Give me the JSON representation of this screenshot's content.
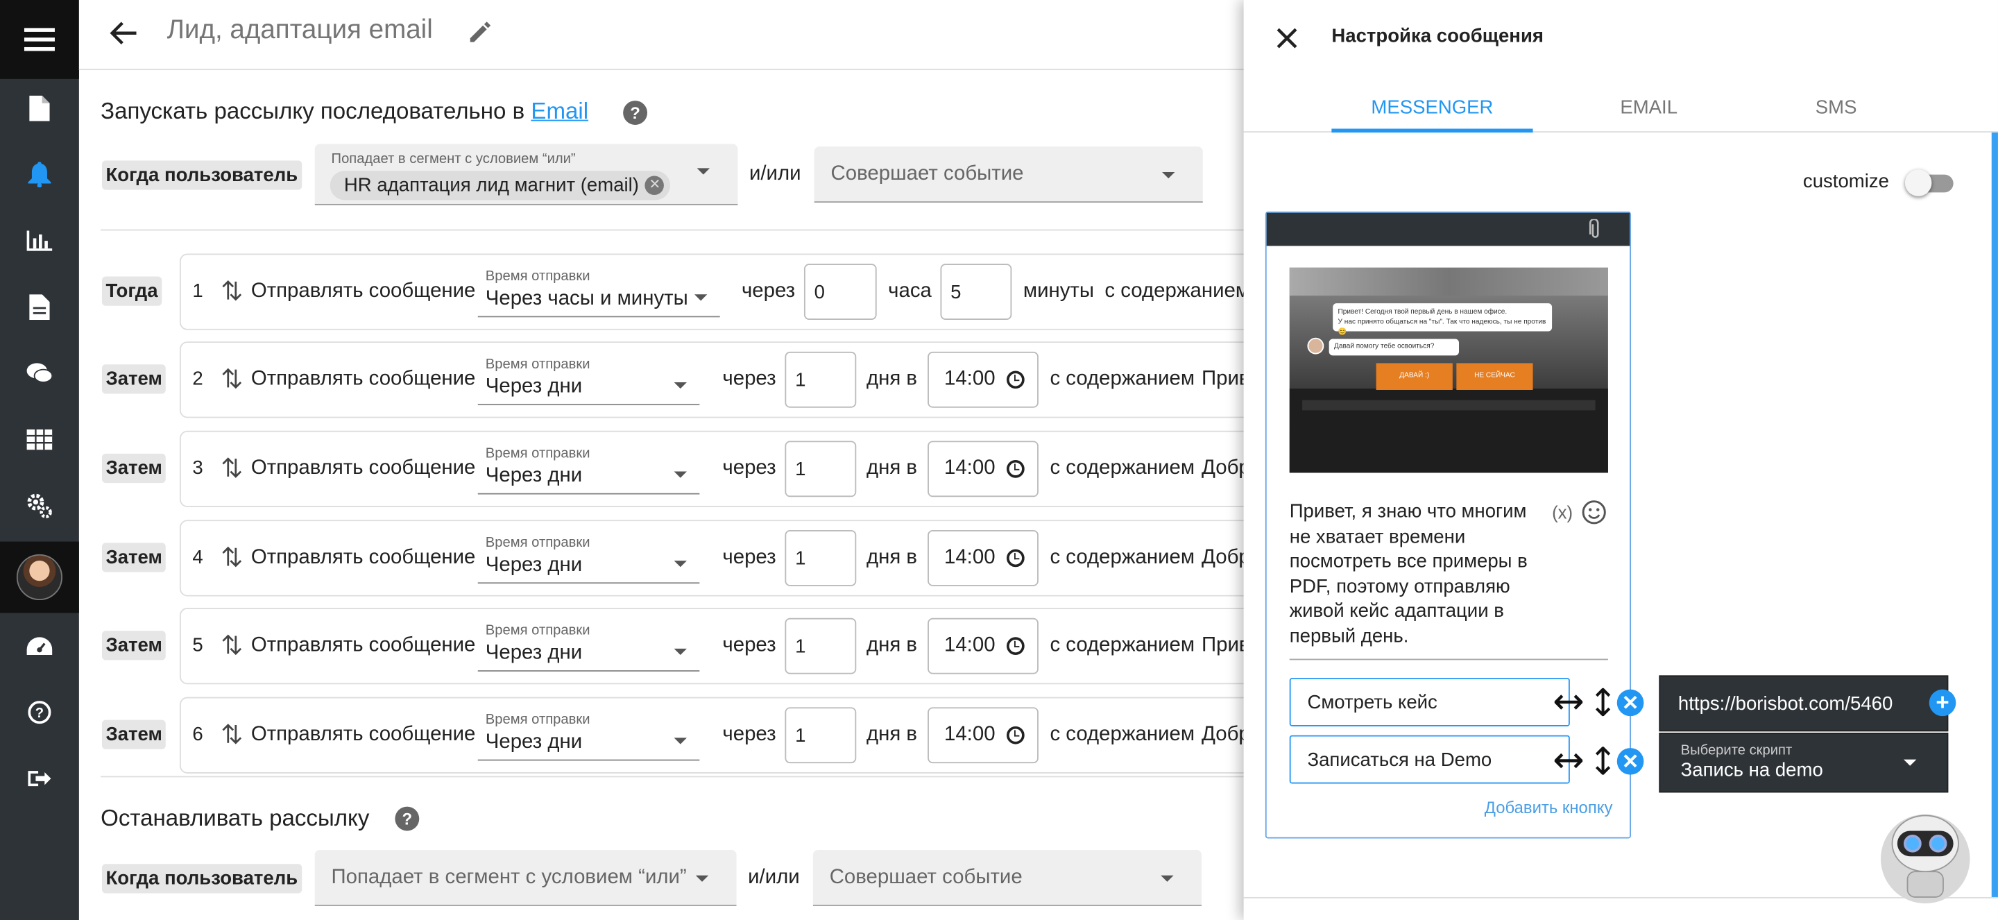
{
  "header": {
    "title": "Лид, адаптация email"
  },
  "start_section": {
    "heading": "Запускать рассылку последовательно в",
    "channel_link": "Email",
    "when_label": "Когда пользователь",
    "segment_label": "Попадает в сегмент с условием “или”",
    "segment_chip": "HR адаптация лид магнит (email)",
    "andor": "и/или",
    "event_placeholder": "Совершает событие"
  },
  "steps": [
    {
      "label": "Тогда",
      "num": "1",
      "action": "Отправлять сообщение",
      "time_label": "Время отправки",
      "time_mode": "Через часы и минуты",
      "via": "через",
      "v1": "0",
      "u1": "часа",
      "v2": "5",
      "u2": "минуты",
      "content": "с содержанием",
      "preview": ""
    },
    {
      "label": "Затем",
      "num": "2",
      "action": "Отправлять сообщение",
      "time_label": "Время отправки",
      "time_mode": "Через дни",
      "via": "через",
      "v1": "1",
      "u1": "дня в",
      "time": "14:00",
      "content": "с содержанием",
      "preview": "Прив"
    },
    {
      "label": "Затем",
      "num": "3",
      "action": "Отправлять сообщение",
      "time_label": "Время отправки",
      "time_mode": "Через дни",
      "via": "через",
      "v1": "1",
      "u1": "дня в",
      "time": "14:00",
      "content": "с содержанием",
      "preview": "Добр"
    },
    {
      "label": "Затем",
      "num": "4",
      "action": "Отправлять сообщение",
      "time_label": "Время отправки",
      "time_mode": "Через дни",
      "via": "через",
      "v1": "1",
      "u1": "дня в",
      "time": "14:00",
      "content": "с содержанием",
      "preview": "Добр"
    },
    {
      "label": "Затем",
      "num": "5",
      "action": "Отправлять сообщение",
      "time_label": "Время отправки",
      "time_mode": "Через дни",
      "via": "через",
      "v1": "1",
      "u1": "дня в",
      "time": "14:00",
      "content": "с содержанием",
      "preview": "Прив"
    },
    {
      "label": "Затем",
      "num": "6",
      "action": "Отправлять сообщение",
      "time_label": "Время отправки",
      "time_mode": "Через дни",
      "via": "через",
      "v1": "1",
      "u1": "дня в",
      "time": "14:00",
      "content": "с содержанием",
      "preview": "Добр"
    }
  ],
  "stop_section": {
    "heading": "Останавливать рассылку",
    "when_label": "Когда пользователь",
    "segment_placeholder": "Попадает в сегмент с условием “или”",
    "andor": "и/или",
    "event_placeholder": "Совершает событие"
  },
  "panel": {
    "title": "Настройка сообщения",
    "tabs": [
      "MESSENGER",
      "EMAIL",
      "SMS"
    ],
    "active_tab": "MESSENGER",
    "customize_label": "customize",
    "photo_chat": {
      "line1": "Привет! Сегодня твой первый день в нашем офисе.",
      "line2": "У нас принято общаться на \"ты\". Так что надеюсь, ты не против 😊",
      "line3": "Давай помогу тебе освоиться?",
      "btn1": "ДАВАЙ :)",
      "btn2": "НЕ СЕЙЧАС"
    },
    "message_text": "Привет, я знаю что многим не хватает времени посмотреть все примеры в PDF, поэтому отправляю живой кейс адаптации в первый день.",
    "var_token": "(x)",
    "buttons": [
      {
        "label": "Смотреть кейс",
        "target": "https://borisbot.com/5460"
      },
      {
        "label": "Записаться на Demo",
        "target_label": "Выберите скрипт",
        "target": "Запись на demo"
      }
    ],
    "add_button": "Добавить кнопку"
  },
  "colors": {
    "accent": "#2196f3",
    "sidebar": "#2e3338",
    "sidebar_active_icon": "#2196f3"
  }
}
